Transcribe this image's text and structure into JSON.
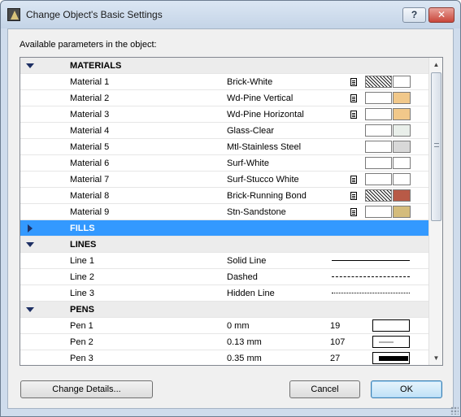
{
  "window": {
    "title": "Change Object's Basic Settings",
    "help_label": "?",
    "close_label": "✕"
  },
  "caption": "Available parameters in the object:",
  "sections": {
    "materials": "MATERIALS",
    "fills": "FILLS",
    "lines": "LINES",
    "pens": "PENS"
  },
  "materials": [
    {
      "name": "Material 1",
      "value": "Brick-White",
      "has_doc": true,
      "swatch": "hatch",
      "color": "#ffffff"
    },
    {
      "name": "Material 2",
      "value": "Wd-Pine Vertical",
      "has_doc": true,
      "swatch": "plain",
      "color": "#f1c88a"
    },
    {
      "name": "Material 3",
      "value": "Wd-Pine Horizontal",
      "has_doc": true,
      "swatch": "plain",
      "color": "#f1c88a"
    },
    {
      "name": "Material 4",
      "value": "Glass-Clear",
      "has_doc": false,
      "swatch": "plain",
      "color": "#e9efea"
    },
    {
      "name": "Material 5",
      "value": "Mtl-Stainless Steel",
      "has_doc": false,
      "swatch": "plain",
      "color": "#d8d8d8"
    },
    {
      "name": "Material 6",
      "value": "Surf-White",
      "has_doc": false,
      "swatch": "plain",
      "color": "#ffffff"
    },
    {
      "name": "Material 7",
      "value": "Surf-Stucco White",
      "has_doc": true,
      "swatch": "plain",
      "color": "#ffffff"
    },
    {
      "name": "Material 8",
      "value": "Brick-Running Bond",
      "has_doc": true,
      "swatch": "hatch",
      "color": "#b85a47"
    },
    {
      "name": "Material 9",
      "value": "Stn-Sandstone",
      "has_doc": true,
      "swatch": "plain",
      "color": "#d4bc7c"
    }
  ],
  "lines": [
    {
      "name": "Line 1",
      "value": "Solid Line",
      "style": "solid"
    },
    {
      "name": "Line 2",
      "value": "Dashed",
      "style": "dashed"
    },
    {
      "name": "Line 3",
      "value": "Hidden Line",
      "style": "hidden"
    }
  ],
  "pens": [
    {
      "name": "Pen 1",
      "value": "0 mm",
      "number": "19",
      "color": "#000000",
      "thickness": 0
    },
    {
      "name": "Pen 2",
      "value": "0.13 mm",
      "number": "107",
      "color": "#b0b0b0",
      "thickness": 0.13
    },
    {
      "name": "Pen 3",
      "value": "0.35 mm",
      "number": "27",
      "color": "#000000",
      "thickness": 0.35
    }
  ],
  "buttons": {
    "details": "Change Details...",
    "cancel": "Cancel",
    "ok": "OK"
  },
  "colors": {
    "selection": "#3399ff",
    "section_bg": "#ececec"
  }
}
